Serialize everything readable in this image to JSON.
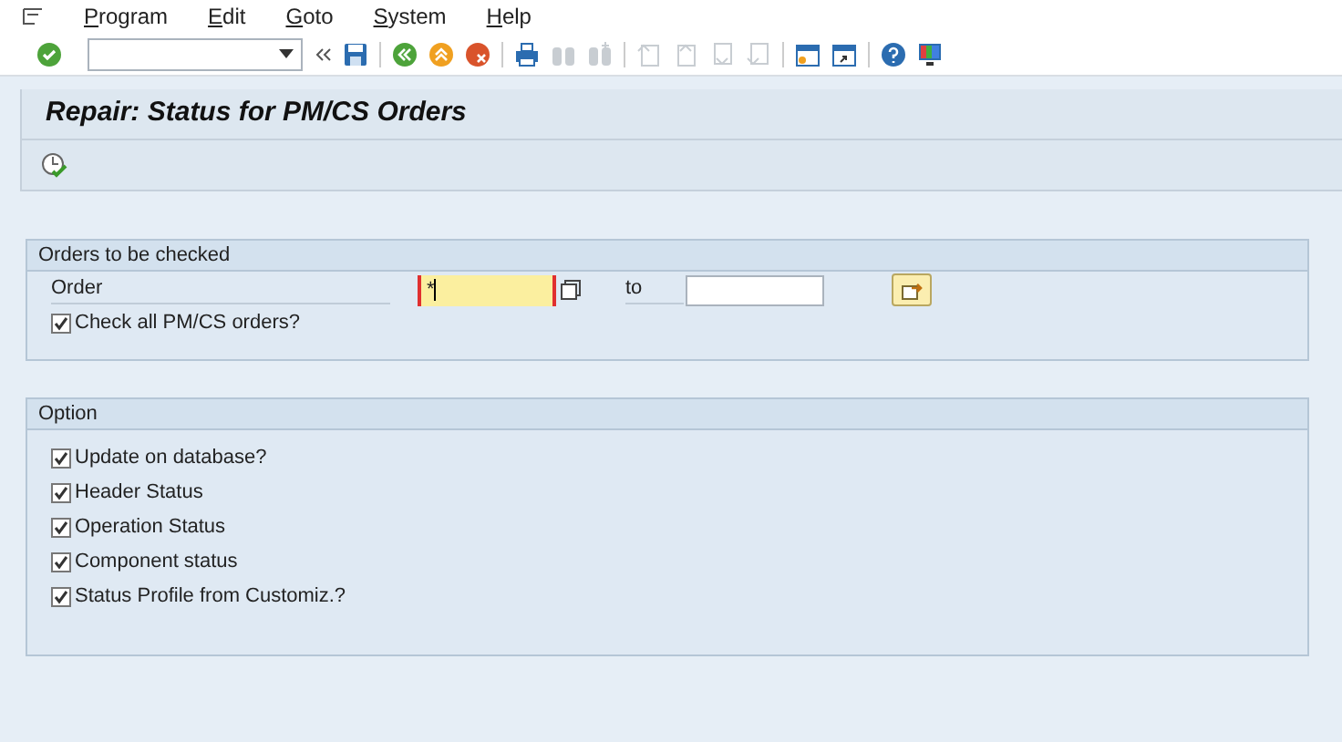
{
  "menu": [
    "Program",
    "Edit",
    "Goto",
    "System",
    "Help"
  ],
  "title": "Repair: Status for PM/CS Orders",
  "groups": [
    {
      "title": "Orders to be checked",
      "fields": [
        {
          "label": "Order",
          "value": "*",
          "focused": true,
          "to_label": "to"
        }
      ],
      "checkboxes": [
        {
          "label": "Check all PM/CS orders?",
          "checked": true
        }
      ]
    },
    {
      "title": "Option",
      "checkboxes": [
        {
          "label": "Update on database?",
          "checked": true
        },
        {
          "label": "Header Status",
          "checked": true
        },
        {
          "label": "Operation Status",
          "checked": true
        },
        {
          "label": "Component status",
          "checked": true
        },
        {
          "label": "Status Profile from Customiz.?",
          "checked": true
        }
      ]
    }
  ]
}
